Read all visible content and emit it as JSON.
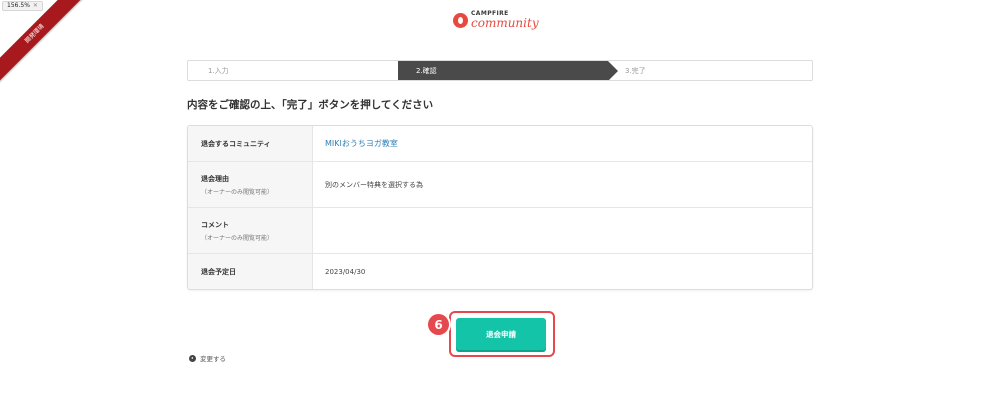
{
  "dev_ribbon": {
    "label": "開発環境"
  },
  "zoom_badge": {
    "value": "156.5",
    "unit": "%",
    "close": "✕"
  },
  "brand": {
    "top": "CAMPFIRE",
    "bottom": "community"
  },
  "steps": [
    {
      "label": "1.入力",
      "state": "done"
    },
    {
      "label": "2.確認",
      "state": "current"
    },
    {
      "label": "3.完了",
      "state": "upcoming"
    }
  ],
  "heading": "内容をご確認の上、「完了」ボタンを押してください",
  "rows": [
    {
      "label": "退会するコミュニティ",
      "sub": "",
      "value": "MIKIおうちヨガ教室",
      "is_link": true
    },
    {
      "label": "退会理由",
      "sub": "（オーナーのみ閲覧可能）",
      "value": "別のメンバー特典を選択する為"
    },
    {
      "label": "コメント",
      "sub": "（オーナーのみ閲覧可能）",
      "value": ""
    },
    {
      "label": "退会予定日",
      "sub": "",
      "value": "2023/04/30"
    }
  ],
  "submit": {
    "label": "退会申請",
    "step_number": "6"
  },
  "back": {
    "label": "変更する"
  },
  "colors": {
    "accent": "#13c4a8",
    "highlight": "#e5484d",
    "brand": "#e8493f",
    "active_step": "#4a4a4a",
    "link": "#2f7fb5"
  }
}
